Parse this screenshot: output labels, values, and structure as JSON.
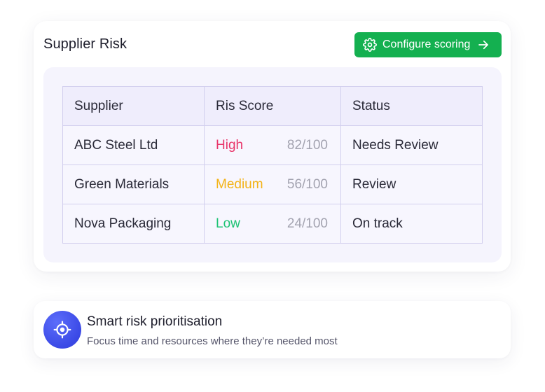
{
  "card": {
    "title": "Supplier Risk",
    "configure_label": "Configure scoring"
  },
  "table": {
    "headers": [
      "Supplier",
      "Ris Score",
      "Status"
    ],
    "rows": [
      {
        "supplier": "ABC Steel Ltd",
        "level": "High",
        "score": "82/100",
        "status": "Needs Review"
      },
      {
        "supplier": "Green Materials",
        "level": "Medium",
        "score": "56/100",
        "status": "Review"
      },
      {
        "supplier": "Nova Packaging",
        "level": "Low",
        "score": "24/100",
        "status": "On track"
      }
    ]
  },
  "feature": {
    "title": "Smart risk prioritisation",
    "subtitle": "Focus time and resources where they’re needed most",
    "icon": "target-icon"
  },
  "colors": {
    "accent_green": "#14b050",
    "high": "#e8356a",
    "medium": "#f3b318",
    "low": "#1dc374",
    "icon_blue": "#3a49e6"
  },
  "icons": {
    "configure": "gear-icon",
    "configure_arrow": "arrow-right-icon"
  }
}
